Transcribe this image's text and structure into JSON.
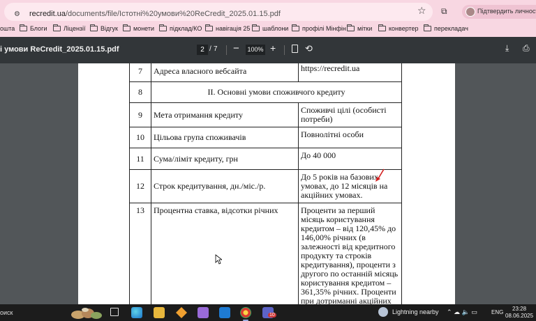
{
  "browser": {
    "url_domain": "recredit.ua",
    "url_path": "/documents/file/Істотні%20умови%20ReCredit_2025.01.15.pdf",
    "profile_label": "Підтвердить личность"
  },
  "bookmarks": [
    {
      "label": "ошта"
    },
    {
      "label": "Блоги"
    },
    {
      "label": "Ліцензії"
    },
    {
      "label": "Відгук"
    },
    {
      "label": "монети"
    },
    {
      "label": "підклад/КО"
    },
    {
      "label": "навігація 25"
    },
    {
      "label": "шаблони"
    },
    {
      "label": "профілі Мінфін"
    },
    {
      "label": "мітки"
    },
    {
      "label": "конвертер"
    },
    {
      "label": "перекладач"
    }
  ],
  "pdf_toolbar": {
    "title": "і умови ReCredit_2025.01.15.pdf",
    "current_page": "2",
    "page_sep": "/",
    "total_pages": "7",
    "zoom": "100%"
  },
  "document": {
    "rows": [
      {
        "num": "7",
        "name": "Адреса власного вебсайта",
        "value": "https://recredit.ua"
      },
      {
        "section": "ІІ. Основні умови споживчого кредиту",
        "num": "8"
      },
      {
        "num": "9",
        "name": "Мета отримання кредиту",
        "value": "Споживчі цілі (особисті потреби)"
      },
      {
        "num": "10",
        "name": "Цільова група споживачів",
        "value": "Повнолітні особи"
      },
      {
        "num": "11",
        "name": "Сума/ліміт кредиту, грн",
        "value": "До 40 000"
      },
      {
        "num": "12",
        "name": "Строк кредитування, дн./міс./р.",
        "value": "До 5 років на базових умовах, до 12 місяців на акційних умовах."
      },
      {
        "num": "13",
        "name": "Процентна ставка, відсотки річних",
        "value": "Проценти за перший місяць користування кредитом – від 120,45% до 146,00% річних (в залежності від кредитного продукту та строків кредитування), проценти з другого по останній місяць користування кредитом – 361,35% річних. Проценти при дотриманні акційних"
      }
    ]
  },
  "taskbar": {
    "search": "оиск",
    "weather": "Lightning nearby",
    "language": "ENG",
    "time": "23:28",
    "date": "08.06.2025",
    "teams_badge": "10"
  }
}
